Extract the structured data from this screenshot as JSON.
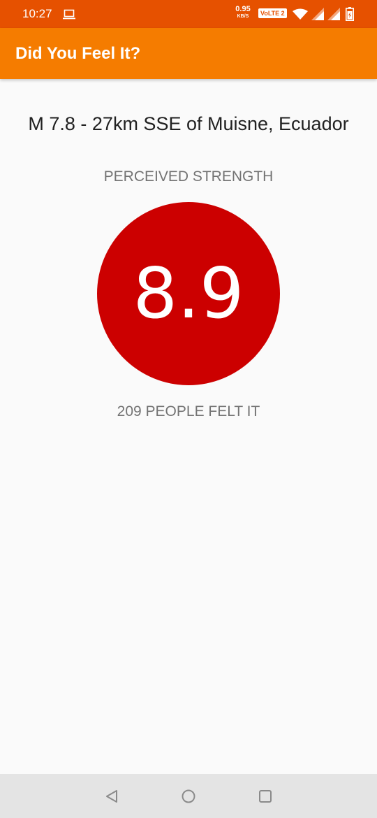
{
  "status_bar": {
    "time": "10:27",
    "net_speed_value": "0.95",
    "net_speed_unit": "KB/S",
    "volte_label": "VoLTE 2",
    "icons": [
      "laptop-icon",
      "wifi-icon",
      "signal-icon",
      "signal-icon",
      "battery-charging-icon"
    ]
  },
  "app_bar": {
    "title": "Did You Feel It?"
  },
  "earthquake": {
    "title": "M 7.8 - 27km SSE of Muisne, Ecuador",
    "strength_label": "PERCEIVED STRENGTH",
    "intensity": "8.9",
    "felt_count": "209 PEOPLE FELT IT"
  },
  "nav_bar": {
    "icons": [
      "back-icon",
      "home-icon",
      "recents-icon"
    ]
  },
  "colors": {
    "status_bar": "#e65100",
    "app_bar": "#f57c00",
    "intensity_circle": "#cc0000",
    "background": "#fafafa",
    "nav_bar": "#e4e4e4"
  }
}
